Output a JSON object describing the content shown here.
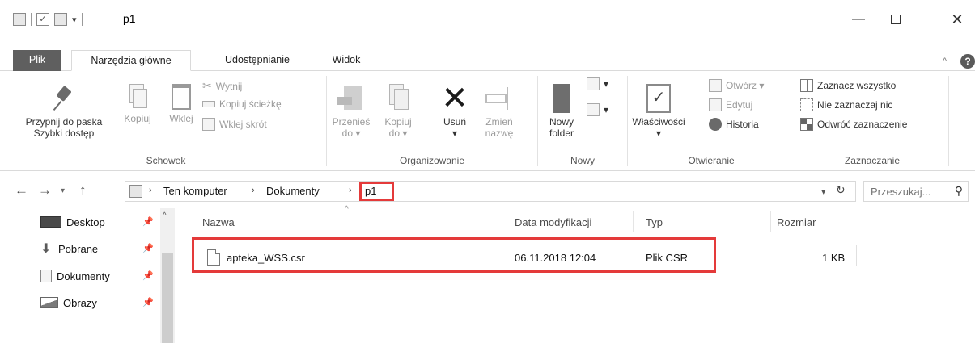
{
  "window": {
    "title": "p1",
    "minimize": "—",
    "close": "✕"
  },
  "tabs": {
    "file": "Plik",
    "home": "Narzędzia główne",
    "share": "Udostępnianie",
    "view": "Widok",
    "help": "?"
  },
  "ribbon": {
    "clipboard": {
      "label": "Schowek",
      "pin_line1": "Przypnij do paska",
      "pin_line2": "Szybki dostęp",
      "copy": "Kopiuj",
      "paste": "Wklej",
      "cut": "Wytnij",
      "copy_path": "Kopiuj ścieżkę",
      "paste_shortcut": "Wklej skrót"
    },
    "organize": {
      "label": "Organizowanie",
      "move_line1": "Przenieś",
      "move_line2": "do ▾",
      "copy_line1": "Kopiuj",
      "copy_line2": "do ▾",
      "delete": "Usuń",
      "delete_arrow": "▾",
      "rename_line1": "Zmień",
      "rename_line2": "nazwę"
    },
    "new": {
      "label": "Nowy",
      "folder_line1": "Nowy",
      "folder_line2": "folder"
    },
    "open": {
      "label": "Otwieranie",
      "properties": "Właściwości",
      "properties_arrow": "▾",
      "open": "Otwórz ▾",
      "edit": "Edytuj",
      "history": "Historia"
    },
    "select": {
      "label": "Zaznaczanie",
      "select_all": "Zaznacz wszystko",
      "select_none": "Nie zaznaczaj nic",
      "invert": "Odwróć zaznaczenie"
    }
  },
  "address": {
    "crumbs": [
      "Ten komputer",
      "Dokumenty",
      "p1"
    ],
    "search_placeholder": "Przeszukaj..."
  },
  "navpane": {
    "items": [
      {
        "label": "Desktop"
      },
      {
        "label": "Pobrane"
      },
      {
        "label": "Dokumenty"
      },
      {
        "label": "Obrazy"
      }
    ]
  },
  "columns": {
    "name": "Nazwa",
    "date": "Data modyfikacji",
    "type": "Typ",
    "size": "Rozmiar"
  },
  "files": [
    {
      "name": "apteka_WSS.csr",
      "date": "06.11.2018 12:04",
      "type": "Plik CSR",
      "size": "1 KB"
    }
  ]
}
